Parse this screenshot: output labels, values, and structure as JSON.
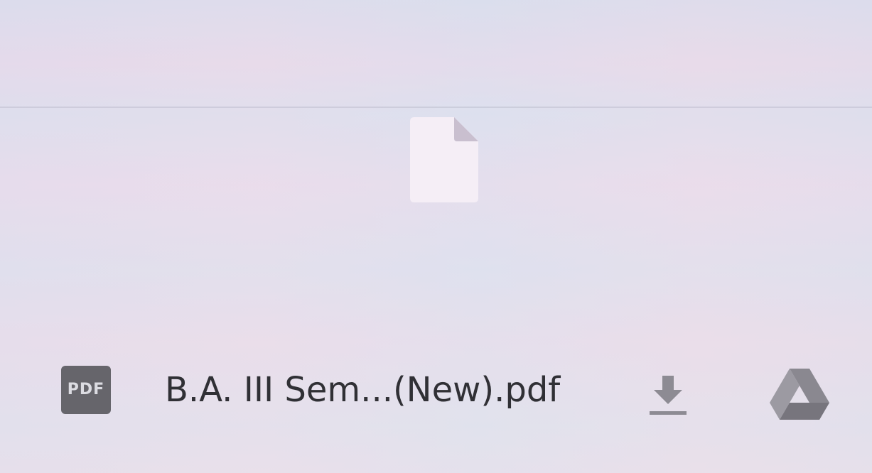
{
  "file": {
    "type_badge": "PDF",
    "name": "B.A. III Sem...(New).pdf"
  },
  "icons": {
    "preview": "file-icon",
    "badge": "pdf-icon",
    "download": "download-icon",
    "drive": "google-drive-icon"
  },
  "colors": {
    "badge_bg": "#66656b",
    "text": "#303035",
    "icon_gray": "#8d8b93"
  }
}
